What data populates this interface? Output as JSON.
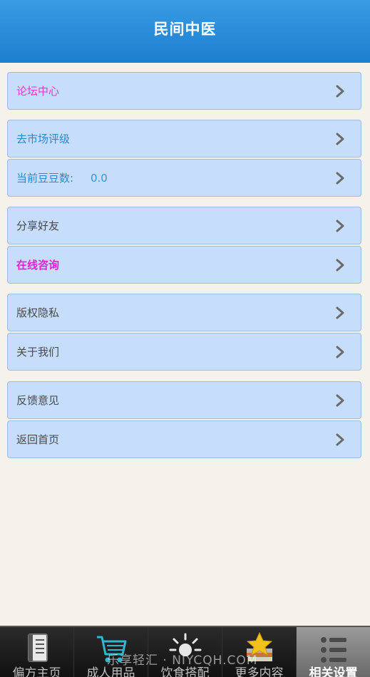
{
  "header": {
    "title": "民间中医"
  },
  "menu": {
    "forum": "论坛中心",
    "market_rating": "去市场评级",
    "beans_label": "当前豆豆数:",
    "beans_value": "0.0",
    "share": "分享好友",
    "consult": "在线咨询",
    "copyright": "版权隐私",
    "about": "关于我们",
    "feedback": "反馈意见",
    "home": "返回首页"
  },
  "tabs": [
    {
      "label": "偏方主页",
      "icon": "book-icon"
    },
    {
      "label": "成人用品",
      "icon": "cart-icon"
    },
    {
      "label": "饮食搭配",
      "icon": "sun-icon"
    },
    {
      "label": "更多内容",
      "icon": "star-books-icon"
    },
    {
      "label": "相关设置",
      "icon": "settings-list-icon"
    }
  ],
  "watermark": "乐享轻汇 · NIYCQH.COM",
  "colors": {
    "header": "#2a8ddb",
    "row_bg": "#c6defb",
    "pink": "#e23bd6",
    "blue": "#2f86cf"
  }
}
